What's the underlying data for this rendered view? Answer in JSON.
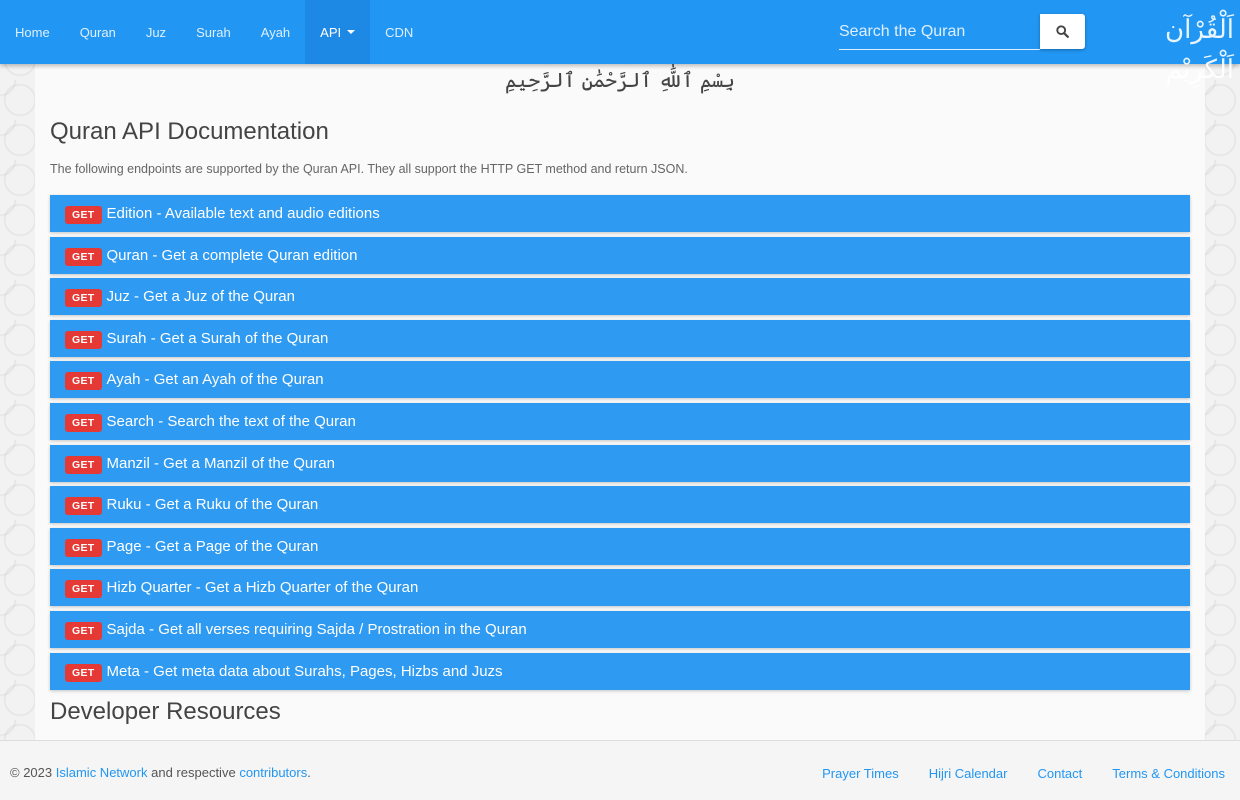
{
  "navbar": {
    "items": [
      {
        "label": "Home"
      },
      {
        "label": "Quran"
      },
      {
        "label": "Juz"
      },
      {
        "label": "Surah"
      },
      {
        "label": "Ayah"
      },
      {
        "label": "API",
        "active": true
      },
      {
        "label": "CDN"
      }
    ],
    "search_placeholder": "Search the Quran",
    "brand": "اَلْقُرْآن اَلْكَرِيْم"
  },
  "main": {
    "bismillah": "بِسْمِ ٱللَّٰهِ ٱلرَّحْمَٰنِ ٱلرَّحِيمِ",
    "title": "Quran API Documentation",
    "intro": "The following endpoints are supported by the Quran API. They all support the HTTP GET method and return JSON.",
    "method_badge": "GET",
    "endpoints": [
      {
        "label": "Edition - Available text and audio editions"
      },
      {
        "label": "Quran - Get a complete Quran edition"
      },
      {
        "label": "Juz - Get a Juz of the Quran"
      },
      {
        "label": "Surah - Get a Surah of the Quran"
      },
      {
        "label": "Ayah - Get an Ayah of the Quran"
      },
      {
        "label": "Search - Search the text of the Quran"
      },
      {
        "label": "Manzil - Get a Manzil of the Quran"
      },
      {
        "label": "Ruku - Get a Ruku of the Quran"
      },
      {
        "label": "Page - Get a Page of the Quran"
      },
      {
        "label": "Hizb Quarter - Get a Hizb Quarter of the Quran"
      },
      {
        "label": "Sajda - Get all verses requiring Sajda / Prostration in the Quran"
      },
      {
        "label": "Meta - Get meta data about Surahs, Pages, Hizbs and Juzs"
      }
    ],
    "section_title": "Developer Resources"
  },
  "footer": {
    "copyright": "© 2023",
    "org_link": "Islamic Network",
    "and_text": "and respective",
    "contributors_link": "contributors",
    "period": ".",
    "links": [
      "Prayer Times",
      "Hijri Calendar",
      "Contact",
      "Terms & Conditions"
    ]
  },
  "colors": {
    "navbar": "#2196f3",
    "endpoint": "#2e9af1",
    "badge": "#e53935",
    "link": "#2196f3"
  }
}
